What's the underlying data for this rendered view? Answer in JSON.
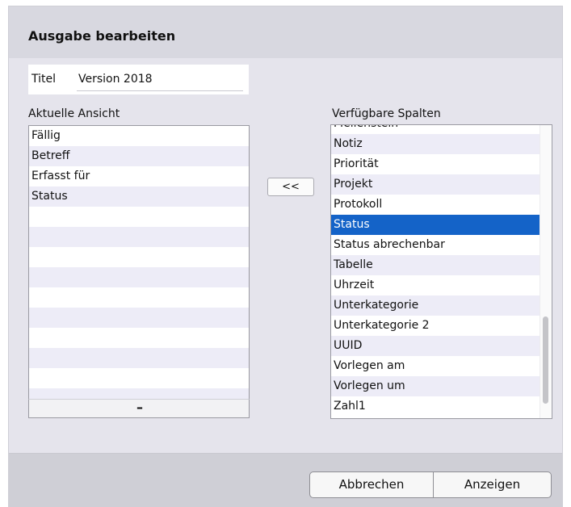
{
  "dialog": {
    "title": "Ausgabe bearbeiten"
  },
  "title_field": {
    "label": "Titel",
    "value": "Version 2018"
  },
  "current_view": {
    "label": "Aktuelle Ansicht",
    "items": [
      "Fällig",
      "Betreff",
      "Erfasst für",
      "Status"
    ],
    "remove_label": "–"
  },
  "move_button": {
    "label": "<<"
  },
  "available_columns": {
    "label": "Verfügbare Spalten",
    "items": [
      "Meilenstein",
      "Notiz",
      "Priorität",
      "Projekt",
      "Protokoll",
      "Status",
      "Status abrechenbar",
      "Tabelle",
      "Uhrzeit",
      "Unterkategorie",
      "Unterkategorie 2",
      "UUID",
      "Vorlegen am",
      "Vorlegen um",
      "Zahl1"
    ],
    "selected": "Status",
    "selection_color": "#1463c8"
  },
  "footer": {
    "cancel_label": "Abbrechen",
    "show_label": "Anzeigen"
  }
}
